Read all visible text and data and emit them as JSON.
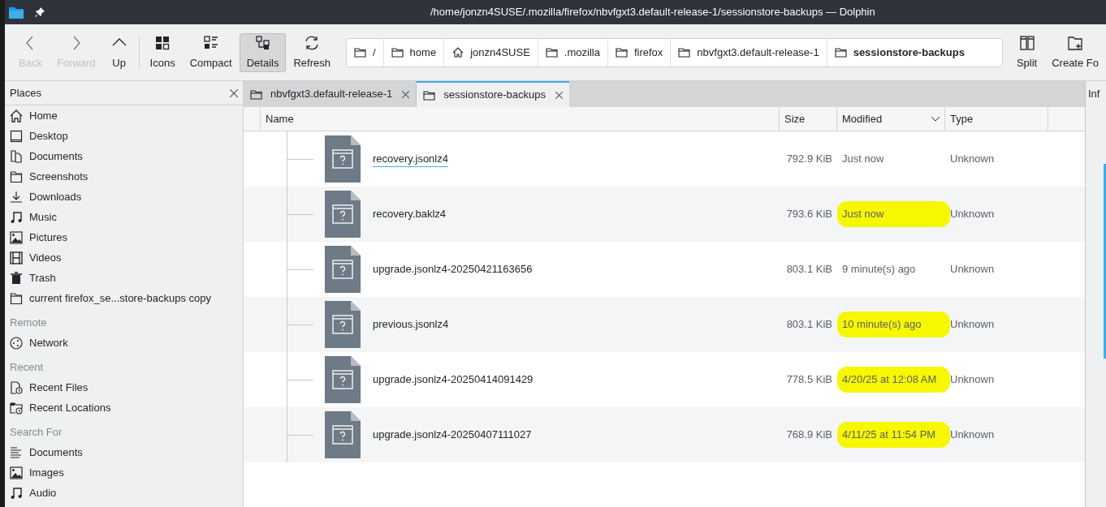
{
  "window": {
    "title": "/home/jonzn4SUSE/.mozilla/firefox/nbvfgxt3.default-release-1/sessionstore-backups — Dolphin"
  },
  "toolbar": [
    {
      "kind": "back",
      "label": "Back",
      "disabled": true,
      "selected": false
    },
    {
      "kind": "forward",
      "label": "Forward",
      "disabled": true,
      "selected": false
    },
    {
      "kind": "up",
      "label": "Up",
      "disabled": false,
      "selected": false
    },
    {
      "kind": "icons",
      "label": "Icons",
      "disabled": false,
      "selected": false
    },
    {
      "kind": "compact",
      "label": "Compact",
      "disabled": false,
      "selected": false
    },
    {
      "kind": "details",
      "label": "Details",
      "disabled": false,
      "selected": true
    },
    {
      "kind": "refresh",
      "label": "Refresh",
      "disabled": false,
      "selected": false
    }
  ],
  "breadcrumb": [
    {
      "kind": "folder",
      "label": "/",
      "current": false
    },
    {
      "kind": "folder",
      "label": "home",
      "current": false
    },
    {
      "kind": "home",
      "label": "jonzn4SUSE",
      "current": false
    },
    {
      "kind": "folder",
      "label": ".mozilla",
      "current": false
    },
    {
      "kind": "folder",
      "label": "firefox",
      "current": false
    },
    {
      "kind": "folder",
      "label": "nbvfgxt3.default-release-1",
      "current": false
    },
    {
      "kind": "folder",
      "label": "sessionstore-backups",
      "current": true
    }
  ],
  "toolbar_right": [
    {
      "kind": "split",
      "label": "Split"
    },
    {
      "kind": "create",
      "label": "Create Fo"
    }
  ],
  "places": {
    "title": "Places",
    "sections": [
      {
        "items": [
          {
            "label": "Home"
          },
          {
            "label": "Desktop"
          },
          {
            "label": "Documents"
          },
          {
            "label": "Screenshots"
          },
          {
            "label": "Downloads"
          },
          {
            "label": "Music"
          },
          {
            "label": "Pictures"
          },
          {
            "label": "Videos"
          },
          {
            "label": "Trash"
          },
          {
            "label": "current firefox_se...store-backups copy"
          }
        ]
      },
      {
        "heading": "Remote",
        "items": [
          {
            "label": "Network"
          }
        ]
      },
      {
        "heading": "Recent",
        "items": [
          {
            "label": "Recent Files"
          },
          {
            "label": "Recent Locations"
          }
        ]
      },
      {
        "heading": "Search For",
        "items": [
          {
            "label": "Documents"
          },
          {
            "label": "Images"
          },
          {
            "label": "Audio"
          }
        ]
      }
    ]
  },
  "tabs": [
    {
      "label": "nbvfgxt3.default-release-1",
      "selected": false
    },
    {
      "label": "sessionstore-backups",
      "selected": true
    }
  ],
  "info_panel": {
    "title": "Inf"
  },
  "table": {
    "columns": [
      "Name",
      "Size",
      "Modified",
      "Type"
    ],
    "rows": [
      {
        "name": "recovery.jsonlz4",
        "size": "792.9 KiB",
        "modified": "Just now",
        "type": "Unknown",
        "hovered": true,
        "highlighted": false
      },
      {
        "name": "recovery.baklz4",
        "size": "793.6 KiB",
        "modified": "Just now",
        "type": "Unknown",
        "hovered": false,
        "highlighted": true
      },
      {
        "name": "upgrade.jsonlz4-20250421163656",
        "size": "803.1 KiB",
        "modified": "9 minute(s) ago",
        "type": "Unknown",
        "hovered": false,
        "highlighted": false
      },
      {
        "name": "previous.jsonlz4",
        "size": "803.1 KiB",
        "modified": "10 minute(s) ago",
        "type": "Unknown",
        "hovered": false,
        "highlighted": true
      },
      {
        "name": "upgrade.jsonlz4-20250414091429",
        "size": "778.5 KiB",
        "modified": "4/20/25 at 12:08 AM",
        "type": "Unknown",
        "hovered": false,
        "highlighted": true
      },
      {
        "name": "upgrade.jsonlz4-20250407111027",
        "size": "768.9 KiB",
        "modified": "4/11/25 at 11:54 PM",
        "type": "Unknown",
        "hovered": false,
        "highlighted": true
      }
    ]
  }
}
